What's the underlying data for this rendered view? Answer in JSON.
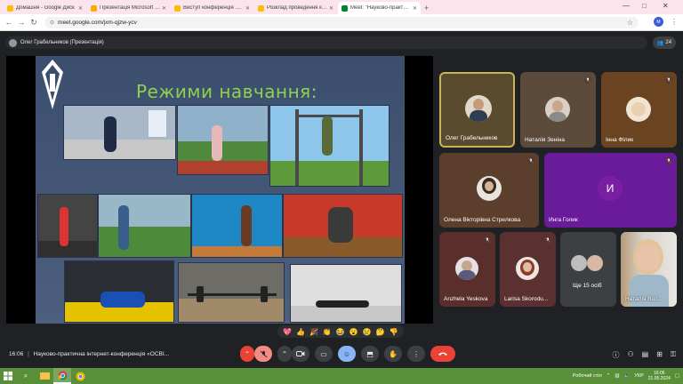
{
  "browser": {
    "tabs": [
      {
        "label": "Домашня - Google Диск",
        "favicon_color": "#fbbc04",
        "active": false
      },
      {
        "label": "Презентація Microsoft PowerP",
        "favicon_color": "#f9ab00",
        "active": false
      },
      {
        "label": "Виступ конференція .pptx - G",
        "favicon_color": "#fbbc04",
        "active": false
      },
      {
        "label": "Розклад проведення конфер",
        "favicon_color": "#fbbc04",
        "active": false
      },
      {
        "label": "Meet: \"Науково-практично",
        "favicon_color": "#00832d",
        "active": true
      }
    ],
    "url": "meet.google.com/jxm-qjzw-ycv",
    "profile_initial": "M",
    "window_controls": [
      "—",
      "□",
      "✕"
    ]
  },
  "meet": {
    "presenter_label": "Олег Грабельников (Презентація)",
    "participants_count": "24",
    "slide": {
      "title": "Режими навчання:"
    },
    "tiles": [
      {
        "name": "Олег Грабельников",
        "muted": false,
        "active_speaker": true
      },
      {
        "name": "Наталія Зеніна",
        "muted": true
      },
      {
        "name": "Інна Філик",
        "muted": true
      },
      {
        "name": "Олена Вікторівна Стрелкова",
        "muted": true
      },
      {
        "name": "Инга Голик",
        "muted": true,
        "initial": "И"
      },
      {
        "name": "Anzhela Yeskova",
        "muted": true
      },
      {
        "name": "Larisa Skorodu...",
        "muted": true
      },
      {
        "name": "Ще 15 осіб",
        "muted": false
      },
      {
        "name": "Наталія Вос...",
        "muted": false
      }
    ],
    "time": "16:06",
    "meeting_title": "Науково-практична інтернет-конференція «ОСВІ...",
    "reactions": [
      "💖",
      "👍",
      "🎉",
      "👏",
      "😂",
      "😮",
      "😢",
      "🤔",
      "👎"
    ]
  },
  "taskbar": {
    "language": "УКР",
    "clock_time": "16:06",
    "clock_date": "21.05.2024",
    "tray_label": "Робочий стіл"
  }
}
